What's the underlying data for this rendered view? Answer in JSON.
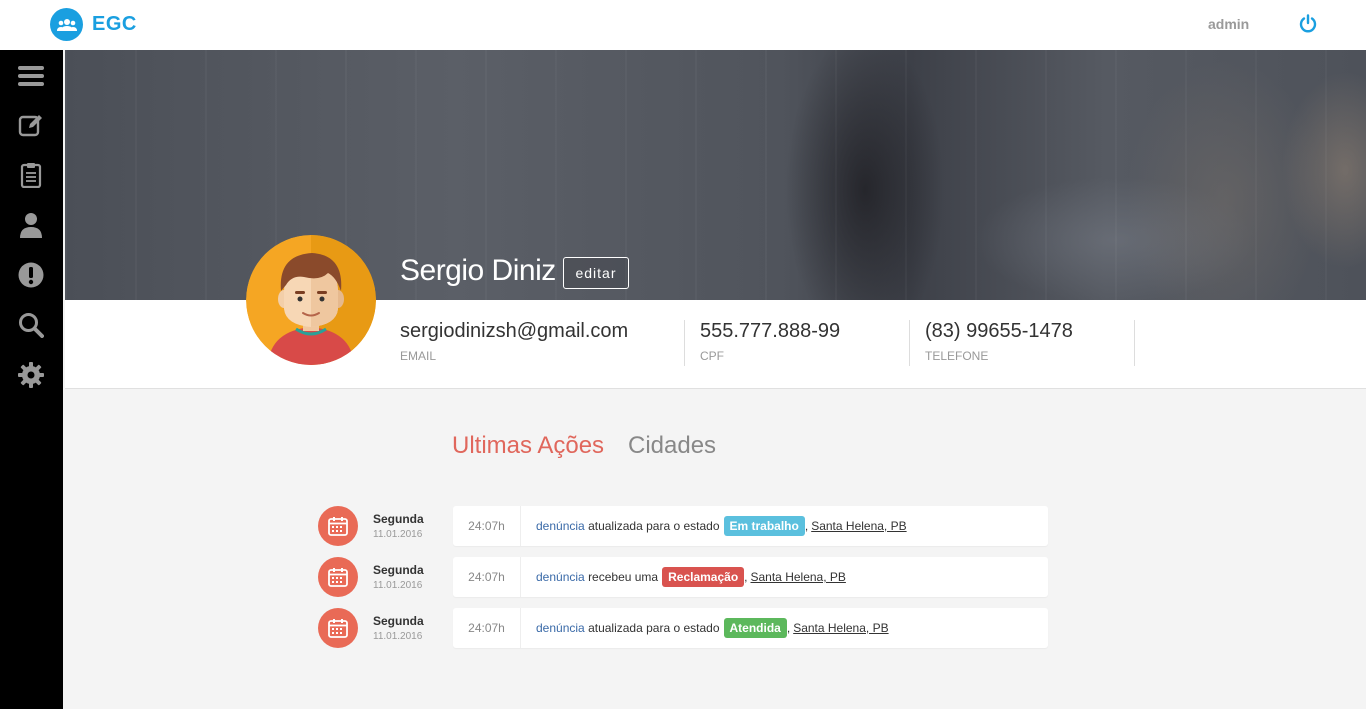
{
  "brand": {
    "name": "EGC",
    "icon": "users-icon",
    "color": "#1a9fe0"
  },
  "header": {
    "user": "admin",
    "power_icon": "power-icon"
  },
  "sidebar": {
    "items": [
      {
        "name": "menu",
        "icon": "hamburger-icon"
      },
      {
        "name": "edit",
        "icon": "edit-icon"
      },
      {
        "name": "reports",
        "icon": "clipboard-icon"
      },
      {
        "name": "profile",
        "icon": "user-icon"
      },
      {
        "name": "alerts",
        "icon": "exclamation-icon"
      },
      {
        "name": "search",
        "icon": "search-icon"
      },
      {
        "name": "settings",
        "icon": "gear-icon"
      }
    ]
  },
  "profile": {
    "name": "Sergio Diniz",
    "edit_label": "editar",
    "email": {
      "value": "sergiodinizsh@gmail.com",
      "label": "EMAIL"
    },
    "cpf": {
      "value": "555.777.888-99",
      "label": "CPF"
    },
    "phone": {
      "value": "(83) 99655-1478",
      "label": "TELEFONE"
    }
  },
  "tabs": [
    {
      "label": "Ultimas Ações",
      "active": true
    },
    {
      "label": "Cidades",
      "active": false
    }
  ],
  "timeline": [
    {
      "day": "Segunda",
      "date": "11.01.2016",
      "time": "24:07h",
      "link": "denúncia",
      "text": "atualizada para o estado",
      "badge": "Em trabalho",
      "badge_color": "#5bc0de",
      "place": "Santa Helena, PB"
    },
    {
      "day": "Segunda",
      "date": "11.01.2016",
      "time": "24:07h",
      "link": "denúncia",
      "text": "recebeu uma",
      "badge": "Reclamação",
      "badge_color": "#d9534f",
      "place": "Santa Helena, PB"
    },
    {
      "day": "Segunda",
      "date": "11.01.2016",
      "time": "24:07h",
      "link": "denúncia",
      "text": "atualizada para o estado",
      "badge": "Atendida",
      "badge_color": "#5cb85c",
      "place": "Santa Helena, PB"
    }
  ],
  "colors": {
    "accent": "#e0675c",
    "calendar": "#e96a56",
    "sidebar": "#000000"
  }
}
